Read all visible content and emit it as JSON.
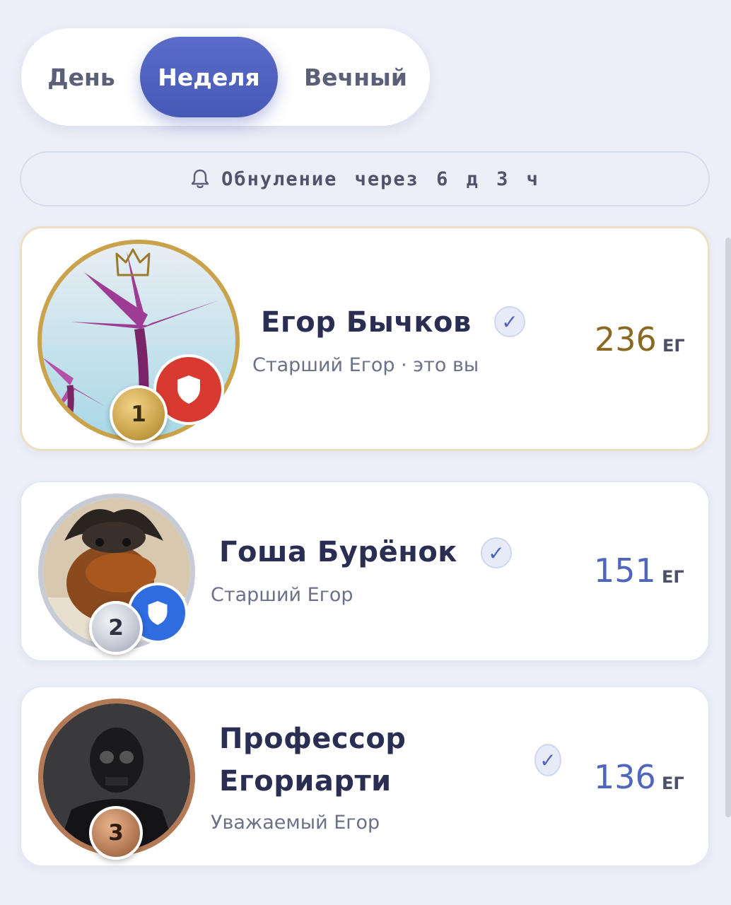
{
  "tabs": [
    {
      "label": "День",
      "active": false
    },
    {
      "label": "Неделя",
      "active": true
    },
    {
      "label": "Вечный",
      "active": false
    }
  ],
  "reset_banner": {
    "icon": "bell-icon",
    "text": "Обнуление через 6 д 3 ч"
  },
  "leaderboard": [
    {
      "rank": "1",
      "name": "Егор Бычков",
      "subtitle": "Старший Егор · это вы",
      "score": "236",
      "unit": "ЕГ",
      "verified": true,
      "score_color": "#8a6a22",
      "badge_color": "#d93a2f"
    },
    {
      "rank": "2",
      "name": "Гоша Бурёнок",
      "subtitle": "Старший Егор",
      "score": "151",
      "unit": "ЕГ",
      "verified": true,
      "score_color": "#5065be",
      "badge_color": "#2f6ce0"
    },
    {
      "rank": "3",
      "name_line1": "Профессор",
      "name_line2": "Егориарти",
      "subtitle": "Уважаемый Егор",
      "score": "136",
      "unit": "ЕГ",
      "verified": true,
      "score_color": "#5065be"
    }
  ],
  "colors": {
    "accent": "#4f63bd",
    "gold": "#c9a24a",
    "silver": "#b9bfcc",
    "bronze": "#b47a55"
  }
}
